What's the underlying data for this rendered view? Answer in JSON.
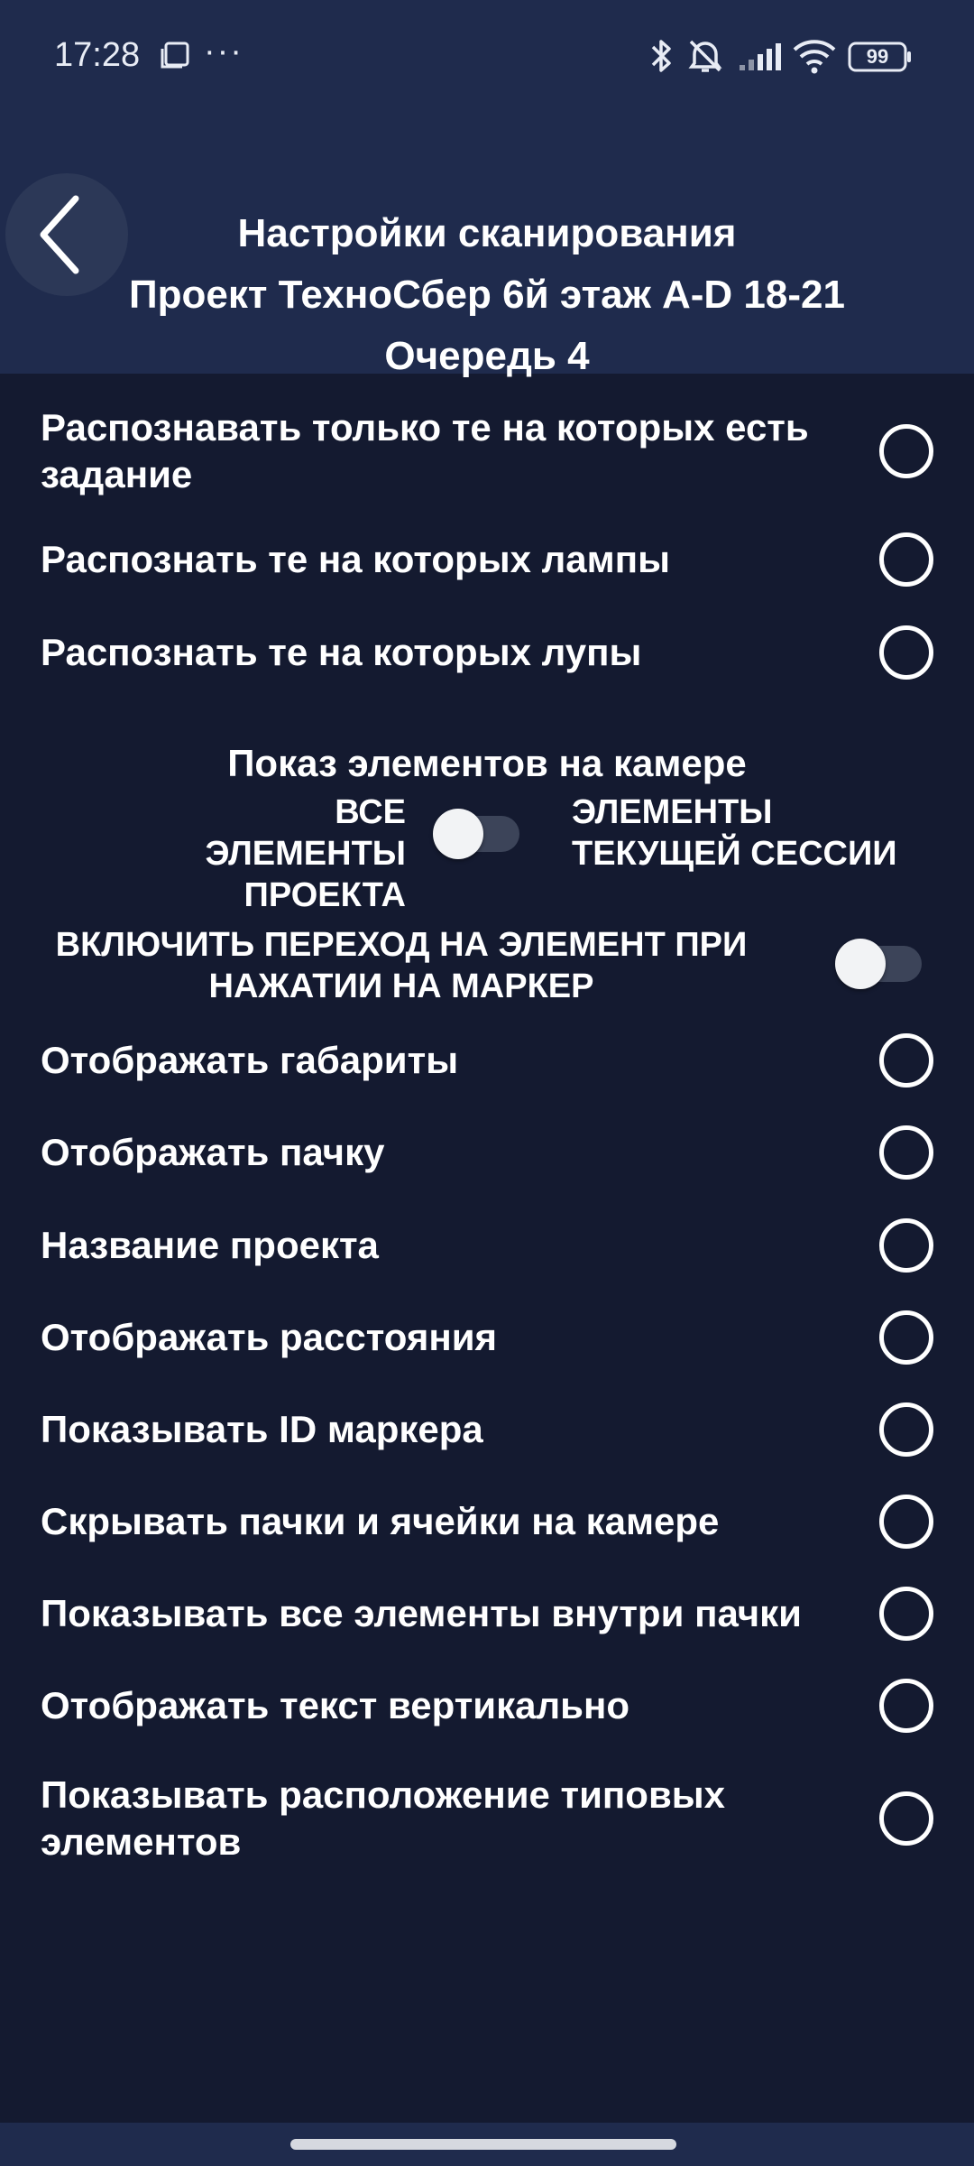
{
  "status_bar": {
    "time": "17:28",
    "more": "···",
    "battery": "99",
    "icons": [
      "screenshot-icon",
      "bluetooth-icon",
      "mute-icon",
      "signal-icon",
      "wifi-icon",
      "battery-icon"
    ]
  },
  "header": {
    "back_icon": "chevron-left-icon",
    "title": "Настройки сканирования",
    "project": "Проект ТехноСбер 6й этаж A-D 18-21",
    "queue": "Очередь 4"
  },
  "options_top": [
    {
      "label": "Распознавать только те на которых есть задание",
      "selected": false
    },
    {
      "label": "Распознать те на которых лампы",
      "selected": false
    },
    {
      "label": "Распознать те на которых лупы",
      "selected": false
    }
  ],
  "camera_display": {
    "title": "Показ элементов на камере",
    "left_label": "ВСЕ ЭЛЕМЕНТЫ ПРОЕКТА",
    "right_label": "ЭЛЕМЕНТЫ ТЕКУЩЕЙ СЕССИИ",
    "toggle_on": false
  },
  "marker_jump": {
    "label": "ВКЛЮЧИТЬ ПЕРЕХОД НА ЭЛЕМЕНТ ПРИ НАЖАТИИ НА МАРКЕР",
    "toggle_on": false
  },
  "options_bottom": [
    {
      "label": "Отображать габариты",
      "selected": false
    },
    {
      "label": "Отображать пачку",
      "selected": false
    },
    {
      "label": "Название проекта",
      "selected": false
    },
    {
      "label": "Отображать расстояния",
      "selected": false
    },
    {
      "label": "Показывать ID маркера",
      "selected": false
    },
    {
      "label": "Скрывать пачки и ячейки на камере",
      "selected": false
    },
    {
      "label": "Показывать все элементы внутри пачки",
      "selected": false
    },
    {
      "label": "Отображать текст вертикально",
      "selected": false
    },
    {
      "label": "Показывать расположение типовых элементов",
      "selected": false
    }
  ],
  "colors": {
    "background": "#141a30",
    "header": "#1f2b4d",
    "text": "#ffffff",
    "toggle_track": "#3c4459"
  }
}
